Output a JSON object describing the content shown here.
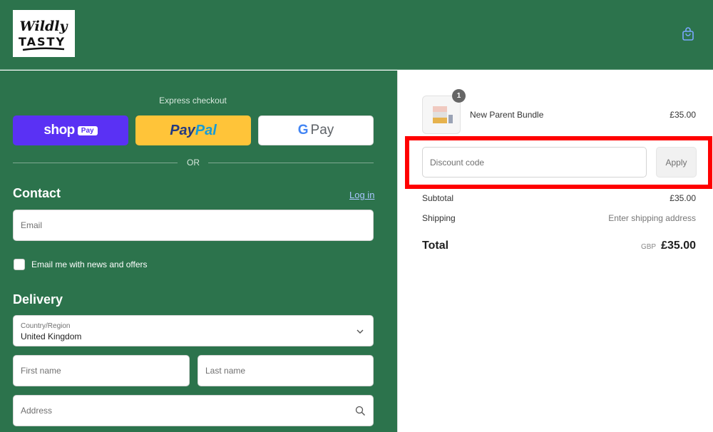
{
  "header": {
    "logo_text_top": "Wildly",
    "logo_text_bottom": "TASTY",
    "brand_color": "#2c734c",
    "cart_icon": "shopping-bag-icon"
  },
  "checkout": {
    "express_label": "Express checkout",
    "shop_pay": {
      "word": "shop",
      "badge": "Pay"
    },
    "paypal": {
      "part1": "Pay",
      "part2": "Pal"
    },
    "gpay": {
      "g": "G",
      "pay": "Pay"
    },
    "or_label": "OR"
  },
  "contact": {
    "title": "Contact",
    "login_link": "Log in",
    "email_placeholder": "Email",
    "newsletter_label": "Email me with news and offers",
    "newsletter_checked": false
  },
  "delivery": {
    "title": "Delivery",
    "country_label": "Country/Region",
    "country_value": "United Kingdom",
    "first_name_placeholder": "First name",
    "last_name_placeholder": "Last name",
    "address_placeholder": "Address"
  },
  "summary": {
    "product": {
      "name": "New Parent Bundle",
      "price": "£35.00",
      "quantity": "1"
    },
    "discount_placeholder": "Discount code",
    "apply_label": "Apply",
    "subtotal_label": "Subtotal",
    "subtotal_value": "£35.00",
    "shipping_label": "Shipping",
    "shipping_value": "Enter shipping address",
    "total_label": "Total",
    "total_currency": "GBP",
    "total_value": "£35.00"
  }
}
